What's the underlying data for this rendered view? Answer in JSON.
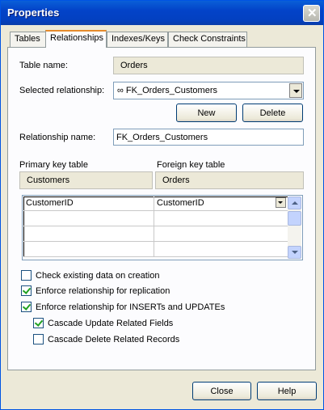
{
  "window": {
    "title": "Properties"
  },
  "tabs": [
    {
      "label": "Tables"
    },
    {
      "label": "Relationships"
    },
    {
      "label": "Indexes/Keys"
    },
    {
      "label": "Check Constraints"
    }
  ],
  "form": {
    "table_name_label": "Table name:",
    "table_name_value": "Orders",
    "selected_relationship_label": "Selected relationship:",
    "selected_relationship_value": "FK_Orders_Customers",
    "new_label": "New",
    "delete_label": "Delete",
    "relationship_name_label": "Relationship name:",
    "relationship_name_value": "FK_Orders_Customers",
    "primary_key_table_label": "Primary key table",
    "primary_key_table_value": "Customers",
    "foreign_key_table_label": "Foreign key table",
    "foreign_key_table_value": "Orders"
  },
  "key_grid": {
    "rows": [
      {
        "primary": "CustomerID",
        "foreign": "CustomerID"
      },
      {
        "primary": "",
        "foreign": ""
      },
      {
        "primary": "",
        "foreign": ""
      },
      {
        "primary": "",
        "foreign": ""
      }
    ]
  },
  "options": [
    {
      "label": "Check existing data on creation",
      "checked": false
    },
    {
      "label": "Enforce relationship for replication",
      "checked": true
    },
    {
      "label": "Enforce relationship for INSERTs and UPDATEs",
      "checked": true
    },
    {
      "label": "Cascade Update Related Fields",
      "checked": true
    },
    {
      "label": "Cascade Delete Related Records",
      "checked": false
    }
  ],
  "footer": {
    "close_label": "Close",
    "help_label": "Help"
  },
  "icons": {
    "relationship": "infinity-icon"
  }
}
